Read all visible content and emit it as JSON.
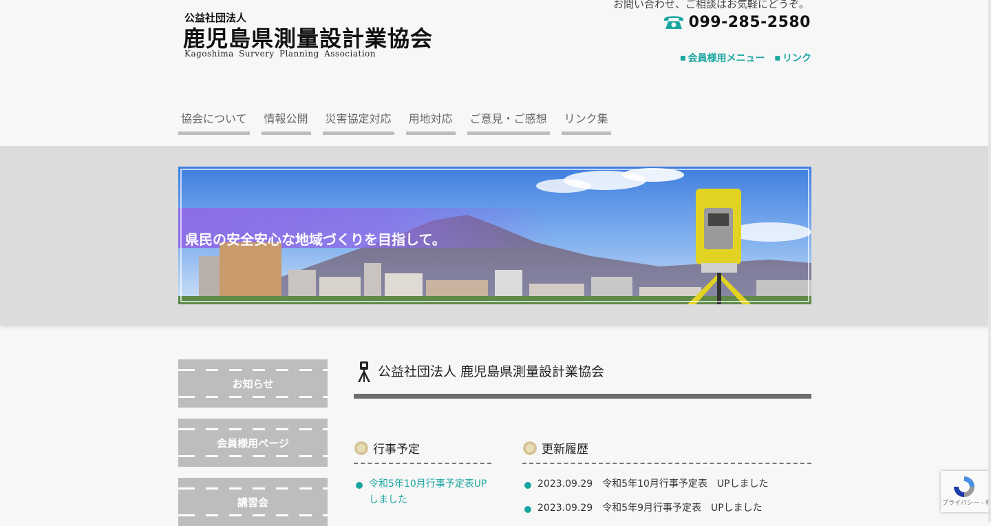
{
  "header": {
    "logo_sub": "公益社団法人",
    "logo_main": "鹿児島県測量設計業協会",
    "logo_en": "Kagoshima Survery Planning Association",
    "contact_note": "お問い合わせ、ご相談はお気軽にどうぞ。",
    "phone": "099-285-2580",
    "links": [
      {
        "label": "会員様用メニュー"
      },
      {
        "label": "リンク"
      }
    ]
  },
  "nav": {
    "items": [
      {
        "label": "協会について"
      },
      {
        "label": "情報公開"
      },
      {
        "label": "災害協定対応"
      },
      {
        "label": "用地対応"
      },
      {
        "label": "ご意見・ご感想"
      },
      {
        "label": "リンク集"
      }
    ]
  },
  "hero": {
    "tagline": "県民の安全安心な地域づくりを目指して。"
  },
  "sidebar": {
    "items": [
      {
        "label": "お知らせ"
      },
      {
        "label": "会員様用ページ"
      },
      {
        "label": "講習会"
      }
    ]
  },
  "main": {
    "title": "公益社団法人 鹿児島県測量設計業協会",
    "events": {
      "heading": "行事予定",
      "items": [
        {
          "label": "令和5年10月行事予定表UPしました"
        }
      ]
    },
    "updates": {
      "heading": "更新履歴",
      "items": [
        {
          "date": "2023.09.29",
          "text": "令和5年10月行事予定表　UPしました"
        },
        {
          "date": "2023.09.29",
          "text": "令和5年9月行事予定表　UPしました"
        }
      ]
    }
  },
  "recaptcha": {
    "text": "プライバシー - 利用規約"
  },
  "colors": {
    "accent": "#1aa6a0",
    "nav_underline": "#bdbdbd",
    "sidebar_bg": "#bdbdbd",
    "title_bar": "#6d6d6d"
  }
}
